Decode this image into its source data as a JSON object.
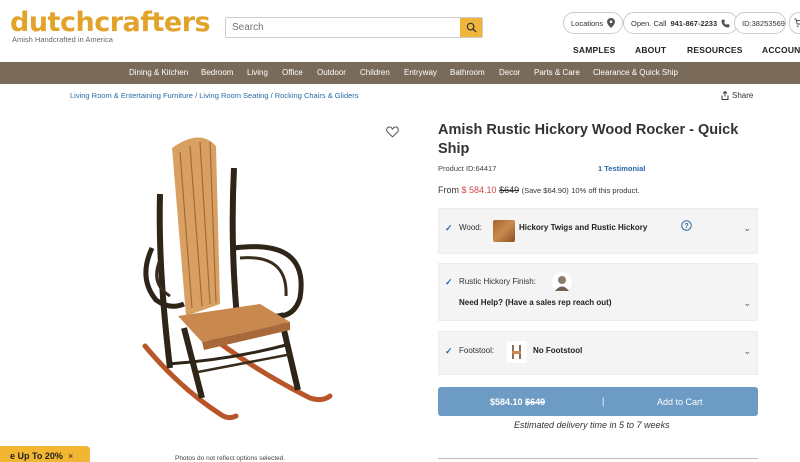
{
  "header": {
    "logo_main_1": "dutch",
    "logo_main_2": "crafters",
    "logo_sub": "Amish Handcrafted in America",
    "search_placeholder": "Search",
    "locations_label": "Locations",
    "phone_label": "Open. Call",
    "phone_number": "941-867-2233",
    "id_label": "ID:38253569",
    "nav": [
      "SAMPLES",
      "ABOUT",
      "RESOURCES",
      "ACCOUNT"
    ]
  },
  "categories": [
    "Dining & Kitchen",
    "Bedroom",
    "Living",
    "Office",
    "Outdoor",
    "Children",
    "Entryway",
    "Bathroom",
    "Decor",
    "Parts & Care",
    "Clearance & Quick Ship"
  ],
  "breadcrumb": {
    "items": [
      "Living Room & Entertaining Furniture",
      "Living Room Seating",
      "Rocking Chairs & Gliders"
    ],
    "separator": "/"
  },
  "share_label": "Share",
  "product": {
    "title": "Amish Rustic Hickory Wood Rocker - Quick Ship",
    "id_text": "Product ID:64417",
    "testimonial": "1 Testimonial",
    "price_from": "From",
    "price_sale": "$ 584.10",
    "price_orig": "$649",
    "price_save": "(Save $64.90)",
    "price_off": "10% off this product.",
    "photo_note": "Photos do not reflect options selected."
  },
  "options": {
    "wood_label": "Wood:",
    "wood_value": "Hickory Twigs and Rustic Hickory",
    "finish_label": "Rustic Hickory Finish:",
    "finish_value": "Need Help? (Have a sales rep reach out)",
    "footstool_label": "Footstool:",
    "footstool_value": "No Footstool"
  },
  "cart": {
    "price": "$584.10",
    "orig": "$649",
    "divider": "|",
    "label": "Add to Cart"
  },
  "delivery": "Estimated delivery time in 5 to 7 weeks",
  "promo": {
    "text": "e Up To 20%",
    "close": "×"
  },
  "colors": {
    "brand": "#e2a32b",
    "catbar": "#7a6a59",
    "link": "#2a6aa8",
    "sale": "#d14545",
    "cart": "#6c9bc4",
    "promo": "#f2b632"
  }
}
